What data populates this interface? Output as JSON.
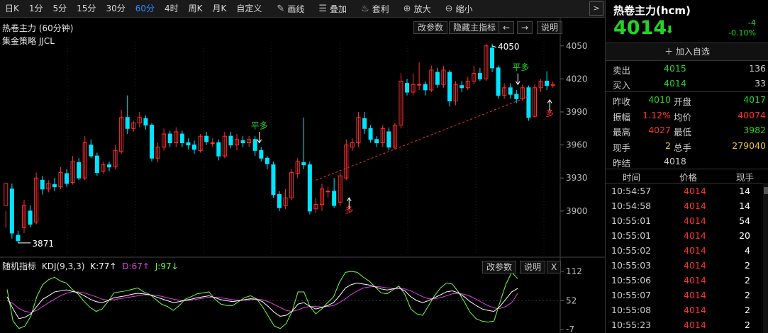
{
  "toolbar": {
    "periods": [
      "日K",
      "1分",
      "5分",
      "15分",
      "30分",
      "60分",
      "4时",
      "周K",
      "月K",
      "自定义"
    ],
    "active_period": "60分",
    "tools": [
      {
        "label": "画线",
        "icon": "pencil-icon",
        "glyph": "✎"
      },
      {
        "label": "叠加",
        "icon": "layers-icon",
        "glyph": "☰"
      },
      {
        "label": "套利",
        "icon": "moneybag-icon",
        "glyph": "♨"
      },
      {
        "label": "放大",
        "icon": "zoom-in-icon",
        "glyph": "⊕"
      },
      {
        "label": "缩小",
        "icon": "zoom-out-icon",
        "glyph": "⊖"
      }
    ],
    "more_glyph": ">"
  },
  "main_chart": {
    "title": "热卷主力 (60分钟)",
    "strategy": "集金策略 JJCL",
    "buttons": {
      "params": "改参数",
      "hide": "隐藏主指标",
      "left": "←",
      "right": "→",
      "help": "说明"
    },
    "price_ticks": [
      "4050",
      "4020",
      "3990",
      "3960",
      "3930",
      "3900"
    ],
    "annotations": {
      "high": "4050",
      "low": "3871",
      "ping1": "平多",
      "ping2": "平多",
      "duo1": "多",
      "duo2": "多"
    }
  },
  "indicator": {
    "name": "随机指标",
    "params": "KDJ(9,3,3)",
    "k": "K:77↑",
    "d": "D:67↑",
    "j": "J:97↓",
    "buttons": {
      "params": "改参数",
      "help": "说明",
      "close": "X"
    },
    "ticks": [
      "112",
      "52",
      "-7"
    ]
  },
  "quote": {
    "title": "热卷主力(hcm)",
    "price": "4014",
    "change": "-4",
    "change_pct": "-0.10%",
    "add_watch": "加入自选",
    "sell": {
      "label": "卖出",
      "price": "4015",
      "vol": "136"
    },
    "buy": {
      "label": "买入",
      "price": "4014",
      "vol": "33"
    },
    "stats": [
      {
        "l1": "昨收",
        "v1": "4010",
        "c1": "#22d422",
        "l2": "开盘",
        "v2": "4017",
        "c2": "#22d422"
      },
      {
        "l1": "振幅",
        "v1": "1.12%",
        "c1": "#ff3030",
        "l2": "均价",
        "v2": "40074",
        "c2": "#ff3030"
      },
      {
        "l1": "最高",
        "v1": "4027",
        "c1": "#ff3030",
        "l2": "最低",
        "v2": "3982",
        "c2": "#22d422"
      },
      {
        "l1": "现手",
        "v1": "2",
        "c1": "#e8c53a",
        "l2": "总手",
        "v2": "279040",
        "c2": "#e8c53a"
      }
    ],
    "settle": {
      "label": "昨结",
      "value": "4018"
    }
  },
  "ticks_table": {
    "headers": [
      "时间",
      "价格",
      "现手"
    ],
    "rows": [
      {
        "time": "10:54:57",
        "price": "4014",
        "vol": "14"
      },
      {
        "time": "10:54:58",
        "price": "4014",
        "vol": "14"
      },
      {
        "time": "10:55:01",
        "price": "4014",
        "vol": "54"
      },
      {
        "time": "10:55:01",
        "price": "4014",
        "vol": "20"
      },
      {
        "time": "10:55:02",
        "price": "4014",
        "vol": "4"
      },
      {
        "time": "10:55:03",
        "price": "4014",
        "vol": "2"
      },
      {
        "time": "10:55:06",
        "price": "4014",
        "vol": "2"
      },
      {
        "time": "10:55:07",
        "price": "4014",
        "vol": "2"
      },
      {
        "time": "10:55:08",
        "price": "4014",
        "vol": "2"
      },
      {
        "time": "10:55:23",
        "price": "4014",
        "vol": "2"
      }
    ]
  },
  "colors": {
    "up": "#ff3030",
    "down": "#00e5ff",
    "k": "#ffffff",
    "d": "#e040e0",
    "j": "#70ff40",
    "ma": "#ffffff",
    "trend": "#ff3030"
  },
  "chart_data": {
    "type": "candlestick",
    "title": "热卷主力 (60分钟)",
    "y_range": [
      3860,
      4055
    ],
    "bars": [
      [
        3905,
        3925,
        3900,
        3885
      ],
      [
        3920,
        3880,
        3925,
        3875
      ],
      [
        3878,
        3873,
        3882,
        3871
      ],
      [
        3885,
        3905,
        3910,
        3880
      ],
      [
        3900,
        3888,
        3905,
        3885
      ],
      [
        3890,
        3930,
        3935,
        3888
      ],
      [
        3928,
        3920,
        3932,
        3915
      ],
      [
        3920,
        3925,
        3928,
        3917
      ],
      [
        3924,
        3922,
        3930,
        3918
      ],
      [
        3922,
        3935,
        3940,
        3920
      ],
      [
        3934,
        3925,
        3938,
        3922
      ],
      [
        3926,
        3945,
        3950,
        3924
      ],
      [
        3944,
        3930,
        3948,
        3928
      ],
      [
        3930,
        3962,
        3968,
        3928
      ],
      [
        3960,
        3950,
        3965,
        3948
      ],
      [
        3950,
        3935,
        3953,
        3932
      ],
      [
        3936,
        3942,
        3945,
        3934
      ],
      [
        3942,
        3940,
        3945,
        3936
      ],
      [
        3940,
        3955,
        3960,
        3938
      ],
      [
        3954,
        3985,
        3992,
        3952
      ],
      [
        3985,
        3975,
        4005,
        3970
      ],
      [
        3975,
        3980,
        3982,
        3972
      ],
      [
        3980,
        3985,
        3990,
        3976
      ],
      [
        3984,
        3978,
        3987,
        3974
      ],
      [
        3978,
        3948,
        3980,
        3945
      ],
      [
        3948,
        3958,
        3962,
        3944
      ],
      [
        3958,
        3970,
        3975,
        3955
      ],
      [
        3970,
        3962,
        3973,
        3958
      ],
      [
        3962,
        3972,
        3976,
        3958
      ],
      [
        3970,
        3962,
        3973,
        3958
      ],
      [
        3962,
        3960,
        3966,
        3956
      ],
      [
        3960,
        3956,
        3964,
        3952
      ],
      [
        3955,
        3968,
        3970,
        3953
      ],
      [
        3968,
        3963,
        3972,
        3960
      ],
      [
        3962,
        3962,
        3966,
        3958
      ],
      [
        3962,
        3950,
        3965,
        3946
      ],
      [
        3950,
        3968,
        3972,
        3948
      ],
      [
        3968,
        3960,
        3972,
        3957
      ],
      [
        3960,
        3965,
        3970,
        3955
      ],
      [
        3964,
        3962,
        3968,
        3958
      ],
      [
        3962,
        3965,
        3968,
        3958
      ],
      [
        3965,
        3955,
        3968,
        3950
      ],
      [
        3955,
        3948,
        3958,
        3945
      ],
      [
        3948,
        3943,
        3950,
        3938
      ],
      [
        3942,
        3915,
        3945,
        3912
      ],
      [
        3915,
        3903,
        3918,
        3900
      ],
      [
        3905,
        3912,
        3920,
        3902
      ],
      [
        3912,
        3935,
        3938,
        3910
      ],
      [
        3934,
        3945,
        3948,
        3930
      ],
      [
        3944,
        3942,
        3985,
        3938
      ],
      [
        3942,
        3900,
        3945,
        3897
      ],
      [
        3902,
        3906,
        3912,
        3898
      ],
      [
        3906,
        3920,
        3925,
        3900
      ],
      [
        3918,
        3918,
        3922,
        3912
      ],
      [
        3918,
        3905,
        3930,
        3903
      ],
      [
        3908,
        3932,
        3935,
        3905
      ],
      [
        3930,
        3960,
        3965,
        3928
      ],
      [
        3958,
        3962,
        3966,
        3955
      ],
      [
        3962,
        3985,
        3990,
        3958
      ],
      [
        3984,
        3975,
        3990,
        3970
      ],
      [
        3975,
        3965,
        3978,
        3962
      ],
      [
        3965,
        3962,
        3968,
        3958
      ],
      [
        3962,
        3975,
        3978,
        3958
      ],
      [
        3972,
        3958,
        3976,
        3955
      ],
      [
        3958,
        3978,
        3980,
        3956
      ],
      [
        3978,
        4018,
        4025,
        3975
      ],
      [
        4016,
        4008,
        4020,
        4005
      ],
      [
        4008,
        4015,
        4025,
        4005
      ],
      [
        4015,
        4015,
        4035,
        4010
      ],
      [
        4015,
        4010,
        4018,
        4005
      ],
      [
        4010,
        4028,
        4032,
        4008
      ],
      [
        4026,
        4015,
        4030,
        4012
      ],
      [
        4015,
        4028,
        4032,
        4012
      ],
      [
        4026,
        4000,
        4028,
        3995
      ],
      [
        4000,
        4015,
        4018,
        3996
      ],
      [
        4014,
        4012,
        4018,
        4008
      ],
      [
        4012,
        4018,
        4022,
        4010
      ],
      [
        4018,
        4025,
        4032,
        4015
      ],
      [
        4025,
        4020,
        4030,
        4018
      ],
      [
        4020,
        4050,
        4052,
        4018
      ],
      [
        4048,
        4030,
        4052,
        4026
      ],
      [
        4030,
        4005,
        4032,
        4002
      ],
      [
        4005,
        4012,
        4016,
        4002
      ],
      [
        4012,
        4006,
        4016,
        4002
      ],
      [
        4006,
        4002,
        4010,
        3998
      ],
      [
        4002,
        4012,
        4015,
        4000
      ],
      [
        4012,
        3985,
        4014,
        3982
      ],
      [
        3986,
        4012,
        4015,
        3985
      ],
      [
        4012,
        4018,
        4020,
        4008
      ],
      [
        4018,
        4014,
        4027,
        4010
      ],
      [
        4014,
        4015,
        4018,
        4012
      ]
    ],
    "kdj": {
      "k": [
        60,
        35,
        15,
        18,
        25,
        40,
        55,
        62,
        70,
        72,
        74,
        71,
        68,
        62,
        55,
        50,
        48,
        52,
        58,
        60,
        62,
        65,
        67,
        66,
        64,
        60,
        56,
        52,
        48,
        50,
        53,
        55,
        58,
        60,
        62,
        58,
        54,
        52,
        50,
        52,
        54,
        56,
        55,
        50,
        40,
        28,
        20,
        22,
        30,
        45,
        48,
        40,
        35,
        38,
        42,
        48,
        62,
        78,
        85,
        88,
        86,
        84,
        80,
        76,
        74,
        76,
        78,
        72,
        60,
        52,
        48,
        52,
        58,
        64,
        70,
        72,
        68,
        60,
        50,
        42,
        35,
        32,
        30,
        40,
        55,
        70,
        77
      ],
      "d": [
        52,
        46,
        36,
        30,
        28,
        32,
        40,
        48,
        55,
        62,
        67,
        70,
        70,
        68,
        64,
        60,
        55,
        53,
        54,
        56,
        58,
        60,
        62,
        64,
        64,
        63,
        61,
        58,
        55,
        53,
        52,
        53,
        55,
        57,
        59,
        59,
        58,
        56,
        54,
        53,
        53,
        54,
        55,
        54,
        50,
        44,
        38,
        32,
        30,
        33,
        38,
        40,
        40,
        39,
        40,
        42,
        48,
        56,
        65,
        72,
        78,
        80,
        81,
        80,
        78,
        77,
        77,
        76,
        72,
        66,
        60,
        56,
        56,
        58,
        62,
        66,
        67,
        65,
        61,
        55,
        48,
        42,
        37,
        36,
        40,
        48,
        67
      ],
      "j": [
        75,
        10,
        -5,
        0,
        20,
        60,
        85,
        95,
        100,
        92,
        88,
        75,
        65,
        50,
        38,
        30,
        35,
        50,
        68,
        70,
        72,
        75,
        78,
        70,
        65,
        55,
        45,
        40,
        32,
        42,
        55,
        60,
        66,
        68,
        70,
        55,
        45,
        42,
        42,
        50,
        58,
        62,
        56,
        40,
        20,
        0,
        -5,
        5,
        30,
        70,
        70,
        40,
        25,
        35,
        48,
        60,
        90,
        110,
        112,
        110,
        100,
        92,
        80,
        68,
        66,
        74,
        82,
        65,
        35,
        25,
        22,
        42,
        62,
        78,
        88,
        86,
        70,
        50,
        28,
        15,
        10,
        8,
        10,
        48,
        85,
        110,
        97
      ]
    }
  }
}
